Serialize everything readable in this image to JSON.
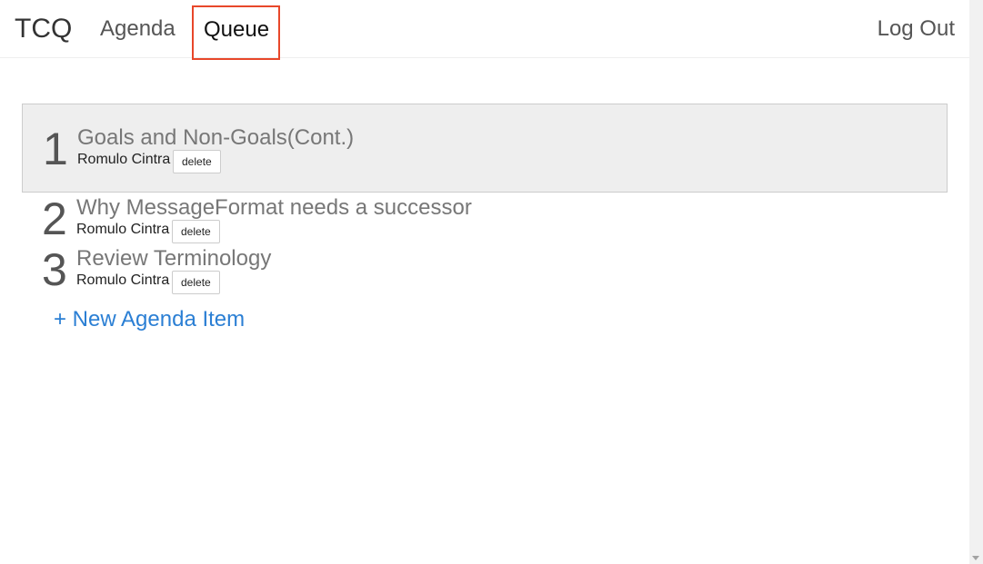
{
  "header": {
    "brand": "TCQ",
    "nav": {
      "agenda": "Agenda",
      "queue": "Queue"
    },
    "logout": "Log Out"
  },
  "agenda": {
    "items": [
      {
        "number": "1",
        "title": "Goals and Non-Goals(Cont.)",
        "owner": "Romulo Cintra",
        "delete_label": "delete"
      },
      {
        "number": "2",
        "title": "Why MessageFormat needs a successor",
        "owner": "Romulo Cintra",
        "delete_label": "delete"
      },
      {
        "number": "3",
        "title": "Review Terminology",
        "owner": "Romulo Cintra",
        "delete_label": "delete"
      }
    ],
    "new_item_label": "+ New Agenda Item"
  },
  "colors": {
    "accent_link": "#2b7fd4",
    "highlight_border": "#e8472a",
    "active_item_bg": "#eeeeee"
  }
}
